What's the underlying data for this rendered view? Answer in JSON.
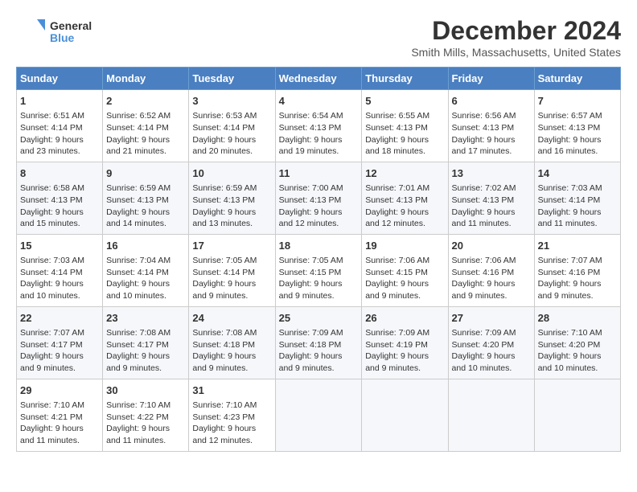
{
  "logo": {
    "line1": "General",
    "line2": "Blue"
  },
  "title": "December 2024",
  "subtitle": "Smith Mills, Massachusetts, United States",
  "weekdays": [
    "Sunday",
    "Monday",
    "Tuesday",
    "Wednesday",
    "Thursday",
    "Friday",
    "Saturday"
  ],
  "weeks": [
    [
      {
        "day": "1",
        "sunrise": "6:51 AM",
        "sunset": "4:14 PM",
        "daylight": "9 hours and 23 minutes."
      },
      {
        "day": "2",
        "sunrise": "6:52 AM",
        "sunset": "4:14 PM",
        "daylight": "9 hours and 21 minutes."
      },
      {
        "day": "3",
        "sunrise": "6:53 AM",
        "sunset": "4:14 PM",
        "daylight": "9 hours and 20 minutes."
      },
      {
        "day": "4",
        "sunrise": "6:54 AM",
        "sunset": "4:13 PM",
        "daylight": "9 hours and 19 minutes."
      },
      {
        "day": "5",
        "sunrise": "6:55 AM",
        "sunset": "4:13 PM",
        "daylight": "9 hours and 18 minutes."
      },
      {
        "day": "6",
        "sunrise": "6:56 AM",
        "sunset": "4:13 PM",
        "daylight": "9 hours and 17 minutes."
      },
      {
        "day": "7",
        "sunrise": "6:57 AM",
        "sunset": "4:13 PM",
        "daylight": "9 hours and 16 minutes."
      }
    ],
    [
      {
        "day": "8",
        "sunrise": "6:58 AM",
        "sunset": "4:13 PM",
        "daylight": "9 hours and 15 minutes."
      },
      {
        "day": "9",
        "sunrise": "6:59 AM",
        "sunset": "4:13 PM",
        "daylight": "9 hours and 14 minutes."
      },
      {
        "day": "10",
        "sunrise": "6:59 AM",
        "sunset": "4:13 PM",
        "daylight": "9 hours and 13 minutes."
      },
      {
        "day": "11",
        "sunrise": "7:00 AM",
        "sunset": "4:13 PM",
        "daylight": "9 hours and 12 minutes."
      },
      {
        "day": "12",
        "sunrise": "7:01 AM",
        "sunset": "4:13 PM",
        "daylight": "9 hours and 12 minutes."
      },
      {
        "day": "13",
        "sunrise": "7:02 AM",
        "sunset": "4:13 PM",
        "daylight": "9 hours and 11 minutes."
      },
      {
        "day": "14",
        "sunrise": "7:03 AM",
        "sunset": "4:14 PM",
        "daylight": "9 hours and 11 minutes."
      }
    ],
    [
      {
        "day": "15",
        "sunrise": "7:03 AM",
        "sunset": "4:14 PM",
        "daylight": "9 hours and 10 minutes."
      },
      {
        "day": "16",
        "sunrise": "7:04 AM",
        "sunset": "4:14 PM",
        "daylight": "9 hours and 10 minutes."
      },
      {
        "day": "17",
        "sunrise": "7:05 AM",
        "sunset": "4:14 PM",
        "daylight": "9 hours and 9 minutes."
      },
      {
        "day": "18",
        "sunrise": "7:05 AM",
        "sunset": "4:15 PM",
        "daylight": "9 hours and 9 minutes."
      },
      {
        "day": "19",
        "sunrise": "7:06 AM",
        "sunset": "4:15 PM",
        "daylight": "9 hours and 9 minutes."
      },
      {
        "day": "20",
        "sunrise": "7:06 AM",
        "sunset": "4:16 PM",
        "daylight": "9 hours and 9 minutes."
      },
      {
        "day": "21",
        "sunrise": "7:07 AM",
        "sunset": "4:16 PM",
        "daylight": "9 hours and 9 minutes."
      }
    ],
    [
      {
        "day": "22",
        "sunrise": "7:07 AM",
        "sunset": "4:17 PM",
        "daylight": "9 hours and 9 minutes."
      },
      {
        "day": "23",
        "sunrise": "7:08 AM",
        "sunset": "4:17 PM",
        "daylight": "9 hours and 9 minutes."
      },
      {
        "day": "24",
        "sunrise": "7:08 AM",
        "sunset": "4:18 PM",
        "daylight": "9 hours and 9 minutes."
      },
      {
        "day": "25",
        "sunrise": "7:09 AM",
        "sunset": "4:18 PM",
        "daylight": "9 hours and 9 minutes."
      },
      {
        "day": "26",
        "sunrise": "7:09 AM",
        "sunset": "4:19 PM",
        "daylight": "9 hours and 9 minutes."
      },
      {
        "day": "27",
        "sunrise": "7:09 AM",
        "sunset": "4:20 PM",
        "daylight": "9 hours and 10 minutes."
      },
      {
        "day": "28",
        "sunrise": "7:10 AM",
        "sunset": "4:20 PM",
        "daylight": "9 hours and 10 minutes."
      }
    ],
    [
      {
        "day": "29",
        "sunrise": "7:10 AM",
        "sunset": "4:21 PM",
        "daylight": "9 hours and 11 minutes."
      },
      {
        "day": "30",
        "sunrise": "7:10 AM",
        "sunset": "4:22 PM",
        "daylight": "9 hours and 11 minutes."
      },
      {
        "day": "31",
        "sunrise": "7:10 AM",
        "sunset": "4:23 PM",
        "daylight": "9 hours and 12 minutes."
      },
      null,
      null,
      null,
      null
    ]
  ],
  "labels": {
    "sunrise": "Sunrise:",
    "sunset": "Sunset:",
    "daylight": "Daylight:"
  }
}
